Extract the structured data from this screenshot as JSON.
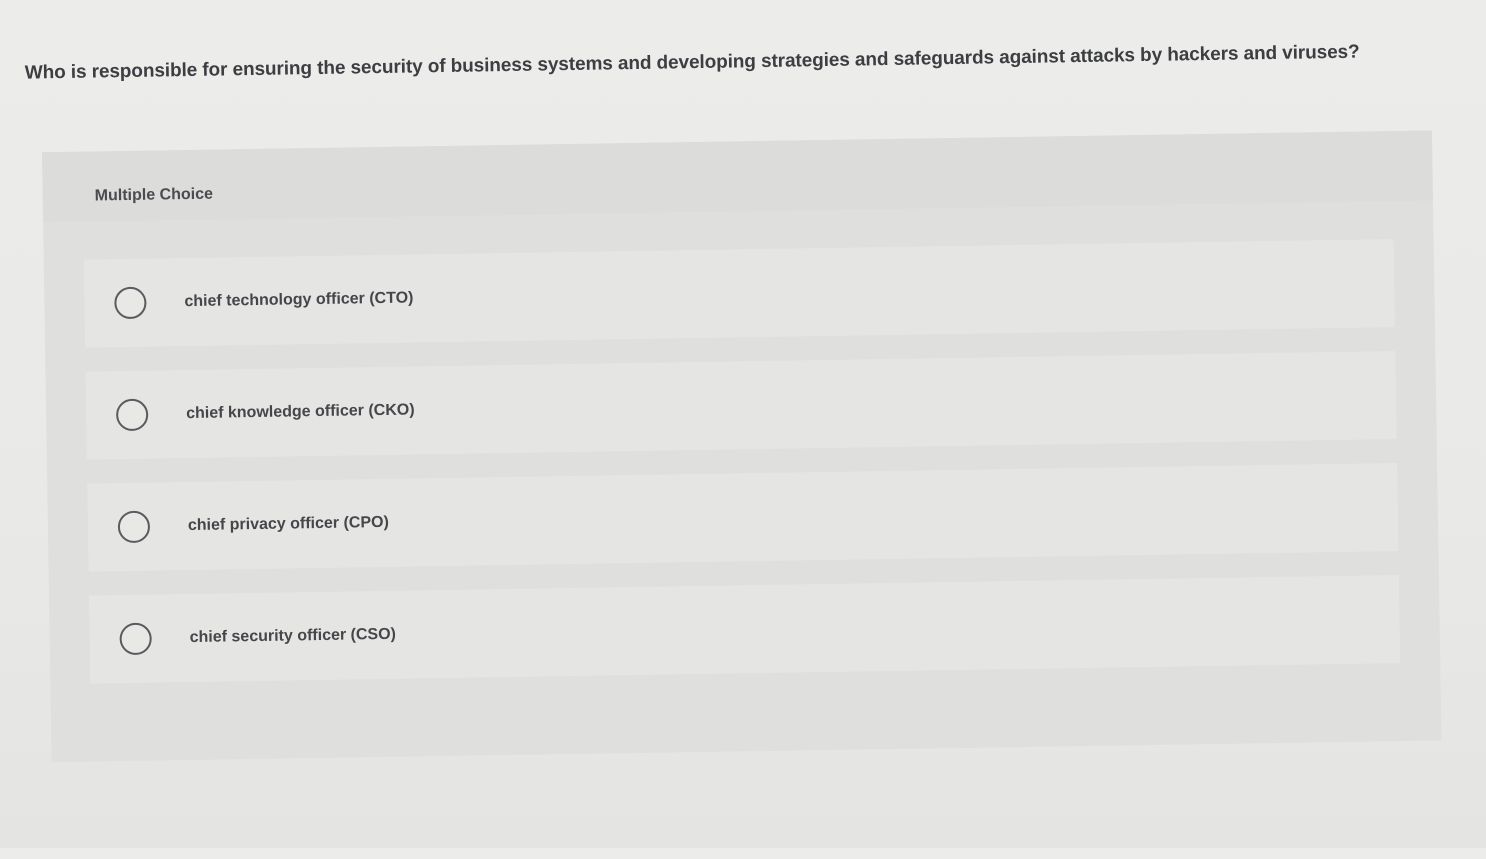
{
  "question": {
    "text": "Who is responsible for ensuring the security of business systems and developing strategies and safeguards against attacks by hackers and viruses?"
  },
  "panel": {
    "label": "Multiple Choice"
  },
  "options": [
    {
      "label": "chief technology officer (CTO)"
    },
    {
      "label": "chief knowledge officer (CKO)"
    },
    {
      "label": "chief privacy officer (CPO)"
    },
    {
      "label": "chief security officer (CSO)"
    }
  ]
}
